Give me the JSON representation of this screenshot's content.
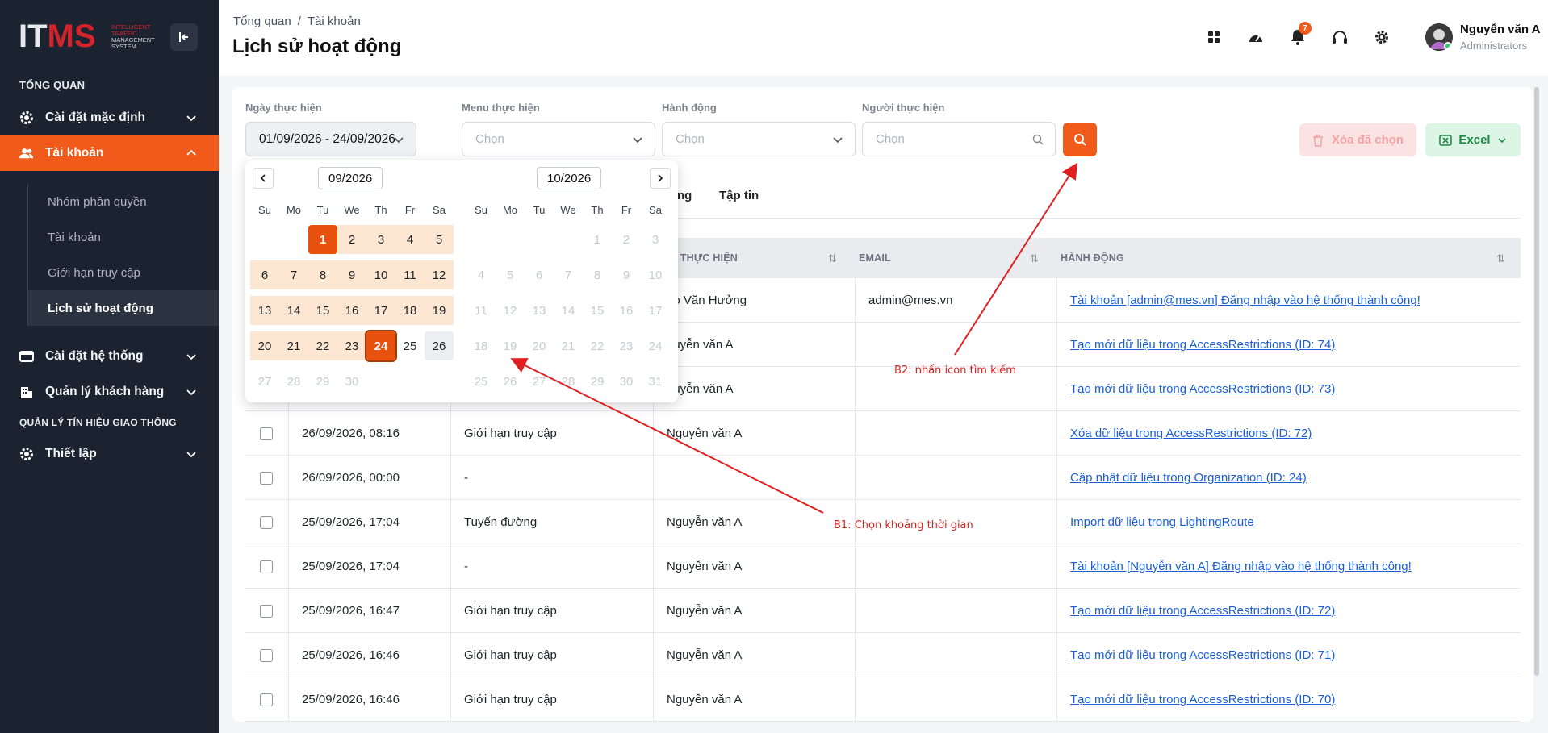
{
  "logo": {
    "main_a": "IT",
    "main_b": "MS",
    "line1": "INTELLIGENT",
    "line2": "TRAFFIC",
    "line3": "MANAGEMENT",
    "line4": "SYSTEM"
  },
  "sidebar": {
    "section1": "TỔNG QUAN",
    "items": [
      {
        "label": "Cài đặt mặc định"
      },
      {
        "label": "Tài khoản"
      }
    ],
    "subitems": [
      "Nhóm phân quyền",
      "Tài khoản",
      "Giới hạn truy cập",
      "Lịch sử hoạt động"
    ],
    "items2": [
      {
        "label": "Cài đặt hệ thống"
      },
      {
        "label": "Quản lý khách hàng"
      }
    ],
    "section2": "QUẢN LÝ TÍN HIỆU GIAO THÔNG",
    "items3": [
      {
        "label": "Thiết lập"
      }
    ]
  },
  "header": {
    "breadcrumb": [
      "Tổng quan",
      "/",
      "Tài khoản"
    ],
    "title": "Lịch sử hoạt động",
    "notif_count": "7",
    "user_name": "Nguyễn văn A",
    "user_role": "Administrators"
  },
  "filters": {
    "date_label": "Ngày thực hiện",
    "date_value": "01/09/2026 - 24/09/2026",
    "menu_label": "Menu thực hiện",
    "menu_placeholder": "Chọn",
    "action_label": "Hành động",
    "action_placeholder": "Chọn",
    "user_label": "Người thực hiện",
    "user_placeholder": "Chọn",
    "delete_label": "Xóa đã chọn",
    "excel_label": "Excel"
  },
  "tabs": [
    "ng",
    "Tập tin"
  ],
  "table": {
    "headers": [
      "ƯỜI THỰC HIỆN",
      "EMAIL",
      "HÀNH ĐỘNG"
    ],
    "rows": [
      {
        "time": "",
        "menu": "",
        "user": "ao Văn Hưởng",
        "email": "admin@mes.vn",
        "action": "Tài khoản [admin@mes.vn] Đăng nhập vào hệ thống thành công!"
      },
      {
        "time": "",
        "menu": "",
        "user": "guyễn văn A",
        "email": "",
        "action": "Tạo mới dữ liệu trong AccessRestrictions (ID: 74)"
      },
      {
        "time": "",
        "menu": "",
        "user": "guyễn văn A",
        "email": "",
        "action": "Tạo mới dữ liệu trong AccessRestrictions (ID: 73)"
      },
      {
        "time": "26/09/2026, 08:16",
        "menu": "Giới hạn truy cập",
        "user": "Nguyễn văn A",
        "email": "",
        "action": "Xóa dữ liệu trong AccessRestrictions (ID: 72)"
      },
      {
        "time": "26/09/2026, 00:00",
        "menu": "-",
        "user": "",
        "email": "",
        "action": "Cập nhật dữ liệu trong Organization (ID: 24)"
      },
      {
        "time": "25/09/2026, 17:04",
        "menu": "Tuyến đường",
        "user": "Nguyễn văn A",
        "email": "",
        "action": "Import dữ liệu trong LightingRoute"
      },
      {
        "time": "25/09/2026, 17:04",
        "menu": "-",
        "user": "Nguyễn văn A",
        "email": "",
        "action": "Tài khoản [Nguyễn văn A] Đăng nhập vào hệ thống thành công!"
      },
      {
        "time": "25/09/2026, 16:47",
        "menu": "Giới hạn truy cập",
        "user": "Nguyễn văn A",
        "email": "",
        "action": "Tạo mới dữ liệu trong AccessRestrictions (ID: 72)"
      },
      {
        "time": "25/09/2026, 16:46",
        "menu": "Giới hạn truy cập",
        "user": "Nguyễn văn A",
        "email": "",
        "action": "Tạo mới dữ liệu trong AccessRestrictions (ID: 71)"
      },
      {
        "time": "25/09/2026, 16:46",
        "menu": "Giới hạn truy cập",
        "user": "Nguyễn văn A",
        "email": "",
        "action": "Tạo mới dữ liệu trong AccessRestrictions (ID: 70)"
      }
    ]
  },
  "picker": {
    "left_month": "09/2026",
    "right_month": "10/2026",
    "dow": [
      "Su",
      "Mo",
      "Tu",
      "We",
      "Th",
      "Fr",
      "Sa"
    ],
    "left_days": [
      "",
      "",
      "1",
      "2",
      "3",
      "4",
      "5",
      "6",
      "7",
      "8",
      "9",
      "10",
      "11",
      "12",
      "13",
      "14",
      "15",
      "16",
      "17",
      "18",
      "19",
      "20",
      "21",
      "22",
      "23",
      "24",
      "25",
      "26",
      "27",
      "28",
      "29",
      "30",
      "",
      "",
      ""
    ],
    "left_states": [
      "",
      "",
      "edge",
      "r",
      "r",
      "r",
      "r",
      "r",
      "r",
      "r",
      "r",
      "r",
      "r",
      "r",
      "r",
      "r",
      "r",
      "r",
      "r",
      "r",
      "r",
      "r",
      "r",
      "r",
      "r",
      "edge2",
      "",
      "hover",
      "m",
      "m",
      "m",
      "m",
      "",
      "",
      ""
    ],
    "right_days": [
      "",
      "",
      "",
      "",
      "1",
      "2",
      "3",
      "4",
      "5",
      "6",
      "7",
      "8",
      "9",
      "10",
      "11",
      "12",
      "13",
      "14",
      "15",
      "16",
      "17",
      "18",
      "19",
      "20",
      "21",
      "22",
      "23",
      "24",
      "25",
      "26",
      "27",
      "28",
      "29",
      "30",
      "31"
    ]
  },
  "annotations": {
    "b1": "B1: Chọn khoảng thời gian",
    "b2": "B2: nhấn icon tìm kiếm"
  },
  "colors": {
    "accent": "#f05a1a",
    "sidebar_bg": "#1c2330",
    "link": "#1a5fd6",
    "annotation": "#e02020"
  }
}
